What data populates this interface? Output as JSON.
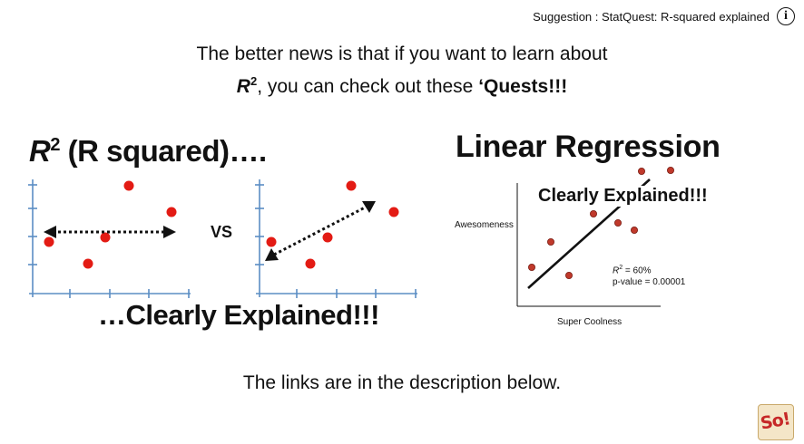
{
  "suggestion": {
    "text": "Suggestion : StatQuest: R-squared explained",
    "icon": "info-icon"
  },
  "caption": {
    "line1": "The better news is that if you want to learn about",
    "r2": "R",
    "r2_sup": "2",
    "line2_mid": ", you can check out these ",
    "line2_bold": "‘Quests!!!"
  },
  "thumb_r2": {
    "title_r": "R",
    "title_sup": "2",
    "title_rest": " (R squared)….",
    "vs": "VS",
    "footer": "…Clearly Explained!!!"
  },
  "thumb_lr": {
    "title": "Linear Regression",
    "subtitle": "Clearly Explained!!!",
    "ylabel": "Awesomeness",
    "xlabel": "Super Coolness",
    "r2_label": "R",
    "r2_sup": "2",
    "r2_value": " = 60%",
    "pvalue": "p-value = 0.00001"
  },
  "bottom_text": "The links are in the description below.",
  "logo_text": "So!",
  "colors": {
    "point": "#e31b14",
    "point_dark": "#c0392b",
    "axis": "#5b8ec4"
  }
}
